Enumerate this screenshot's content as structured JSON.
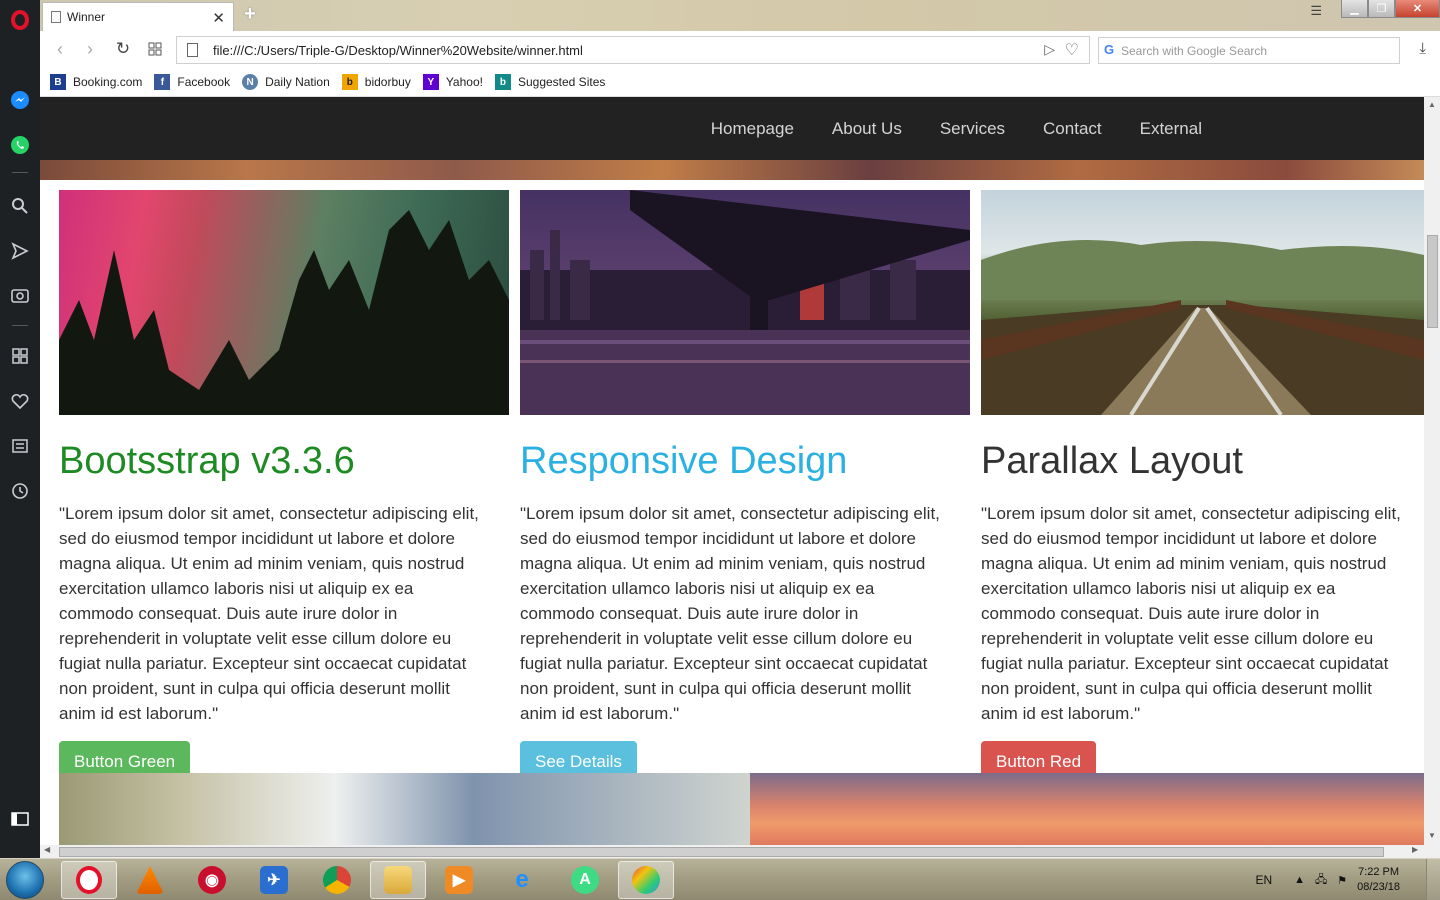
{
  "browser": {
    "tab_title": "Winner",
    "url": "file:///C:/Users/Triple-G/Desktop/Winner%20Website/winner.html",
    "search_placeholder": "Search with Google Search",
    "bookmarks": [
      {
        "label": "Booking.com",
        "icon": "booking-icon",
        "color": "#1d3d8f"
      },
      {
        "label": "Facebook",
        "icon": "facebook-icon",
        "color": "#3b5998"
      },
      {
        "label": "Daily Nation",
        "icon": "daily-nation-icon",
        "color": "#5a7fa8"
      },
      {
        "label": "bidorbuy",
        "icon": "bidorbuy-icon",
        "color": "#f0a500"
      },
      {
        "label": "Yahoo!",
        "icon": "yahoo-icon",
        "color": "#5f01d1"
      },
      {
        "label": "Suggested Sites",
        "icon": "bing-icon",
        "color": "#138a8a"
      }
    ]
  },
  "site": {
    "nav": [
      "Homepage",
      "About Us",
      "Services",
      "Contact",
      "External"
    ],
    "cards": [
      {
        "title": "Bootsstrap v3.3.6",
        "title_color": "#1e8a23",
        "text": "\"Lorem ipsum dolor sit amet, consectetur adipiscing elit, sed do eiusmod tempor incididunt ut labore et dolore magna aliqua. Ut enim ad minim veniam, quis nostrud exercitation ullamco laboris nisi ut aliquip ex ea commodo consequat. Duis aute irure dolor in reprehenderit in voluptate velit esse cillum dolore eu fugiat nulla pariatur. Excepteur sint occaecat cupidatat non proident, sunt in culpa qui officia deserunt mollit anim id est laborum.\"",
        "button": "Button Green",
        "button_color": "#5cb85c"
      },
      {
        "title": "Responsive Design",
        "title_color": "#2bb0e2",
        "text": "\"Lorem ipsum dolor sit amet, consectetur adipiscing elit, sed do eiusmod tempor incididunt ut labore et dolore magna aliqua. Ut enim ad minim veniam, quis nostrud exercitation ullamco laboris nisi ut aliquip ex ea commodo consequat. Duis aute irure dolor in reprehenderit in voluptate velit esse cillum dolore eu fugiat nulla pariatur. Excepteur sint occaecat cupidatat non proident, sunt in culpa qui officia deserunt mollit anim id est laborum.\"",
        "button": "See Details",
        "button_color": "#5bc0de"
      },
      {
        "title": "Parallax Layout",
        "title_color": "#333333",
        "text": "\"Lorem ipsum dolor sit amet, consectetur adipiscing elit, sed do eiusmod tempor incididunt ut labore et dolore magna aliqua. Ut enim ad minim veniam, quis nostrud exercitation ullamco laboris nisi ut aliquip ex ea commodo consequat. Duis aute irure dolor in reprehenderit in voluptate velit esse cillum dolore eu fugiat nulla pariatur. Excepteur sint occaecat cupidatat non proident, sunt in culpa qui officia deserunt mollit anim id est laborum.\"",
        "button": "Button Red",
        "button_color": "#d9534f"
      }
    ]
  },
  "taskbar": {
    "apps": [
      "opera-icon",
      "vlc-icon",
      "antivirus-icon",
      "airplane-icon",
      "chrome-icon",
      "file-explorer-icon",
      "media-player-icon",
      "internet-explorer-icon",
      "android-studio-icon",
      "paint-icon"
    ],
    "language": "EN",
    "time": "7:22 PM",
    "date": "08/23/18"
  }
}
